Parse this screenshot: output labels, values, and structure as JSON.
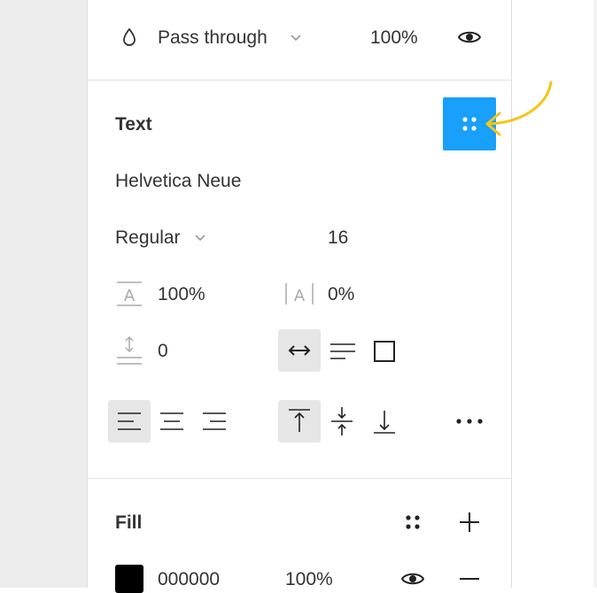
{
  "layer": {
    "blend_mode": "Pass through",
    "opacity": "100%"
  },
  "text_section": {
    "title": "Text",
    "font_family": "Helvetica Neue",
    "font_weight": "Regular",
    "font_size": "16",
    "line_height": "100%",
    "letter_spacing": "0%",
    "paragraph_spacing": "0"
  },
  "fill_section": {
    "title": "Fill",
    "color_hex": "000000",
    "opacity": "100%"
  },
  "colors": {
    "accent_blue": "#18a0fb",
    "annotation_arrow": "#f5c518",
    "selected_bg": "#e6e6e6",
    "swatch": "#000000"
  },
  "icons": [
    "blend-drop-icon",
    "chevron-down-icon",
    "eye-icon",
    "style-grid-icon",
    "line-height-icon",
    "letter-spacing-icon",
    "paragraph-spacing-icon",
    "auto-width-icon",
    "auto-height-icon",
    "fixed-size-icon",
    "align-left-icon",
    "align-center-icon",
    "align-right-icon",
    "align-top-icon",
    "align-middle-icon",
    "align-bottom-icon",
    "more-options-icon",
    "plus-icon",
    "minus-icon",
    "annotation-arrow-icon"
  ]
}
